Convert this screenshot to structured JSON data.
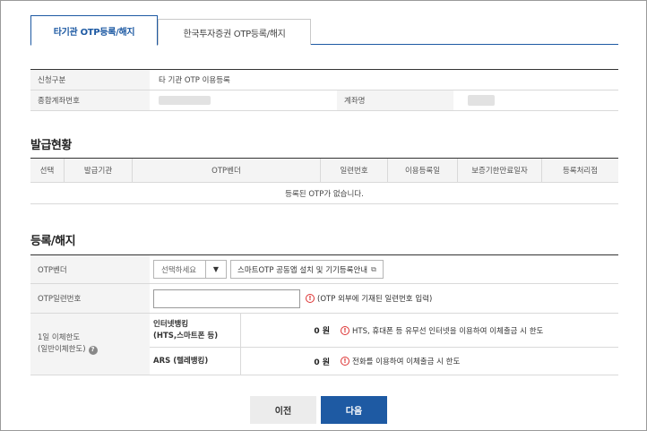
{
  "tabs": [
    {
      "label": "타기관 OTP등록/해지",
      "active": true
    },
    {
      "label": "한국투자증권 OTP등록/해지",
      "active": false
    }
  ],
  "info": {
    "request_type_label": "신청구분",
    "request_type_value": "타 기관 OTP 이용등록",
    "account_no_label": "종합계좌번호",
    "account_name_label": "계좌명"
  },
  "issue": {
    "title": "발급현황",
    "columns": [
      "선택",
      "발급기관",
      "OTP벤더",
      "일련번호",
      "이용등록일",
      "보증기한만료일자",
      "등록처리점"
    ],
    "empty_message": "등록된 OTP가 없습니다."
  },
  "register": {
    "title": "등록/해지",
    "vendor_label": "OTP벤더",
    "vendor_select_placeholder": "선택하세요",
    "vendor_guide_button": "스마트OTP 공동앱 설치 및 기기등록안내",
    "serial_label": "OTP일련번호",
    "serial_value": "",
    "serial_note": "(OTP 외부에 기재된 일련번호 입력)",
    "limit_label_line1": "1일 이체한도",
    "limit_label_line2": "(일반이체한도)",
    "internet_label_line1": "인터넷뱅킹",
    "internet_label_line2": "(HTS,스마트폰 등)",
    "internet_amount": "0 원",
    "internet_note": "HTS, 휴대폰 등 유무선 인터넷을 이용하여 이체출금 시 한도",
    "ars_label": "ARS (텔레뱅킹)",
    "ars_amount": "0 원",
    "ars_note": "전화를 이용하여 이체출금 시 한도"
  },
  "buttons": {
    "prev": "이전",
    "next": "다음"
  },
  "colors": {
    "accent": "#1e5aa3",
    "alert": "#d33333"
  },
  "icons": {
    "alert": "exclamation-circle-icon",
    "help": "question-circle-icon",
    "dropdown": "caret-down-icon",
    "external": "new-window-icon"
  }
}
